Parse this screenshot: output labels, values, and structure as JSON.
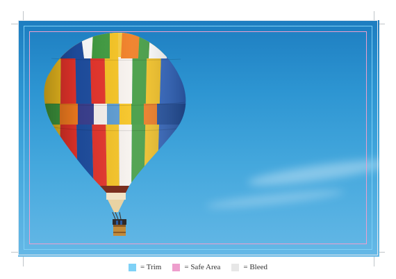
{
  "legend": {
    "items": [
      {
        "label": "= Trim",
        "color": "#7fd1f6",
        "name": "trim"
      },
      {
        "label": "= Safe Area",
        "color": "#ee9fcd",
        "name": "safe-area"
      },
      {
        "label": "= Bleed",
        "color": "#e7e7e7",
        "name": "bleed"
      }
    ]
  },
  "artwork": {
    "subject": "hot-air-balloon",
    "colors": [
      "#e6332a",
      "#f6c320",
      "#3f9b3f",
      "#1e4ea1",
      "#f07b1f",
      "#ffffff",
      "#3a3f8f"
    ]
  }
}
